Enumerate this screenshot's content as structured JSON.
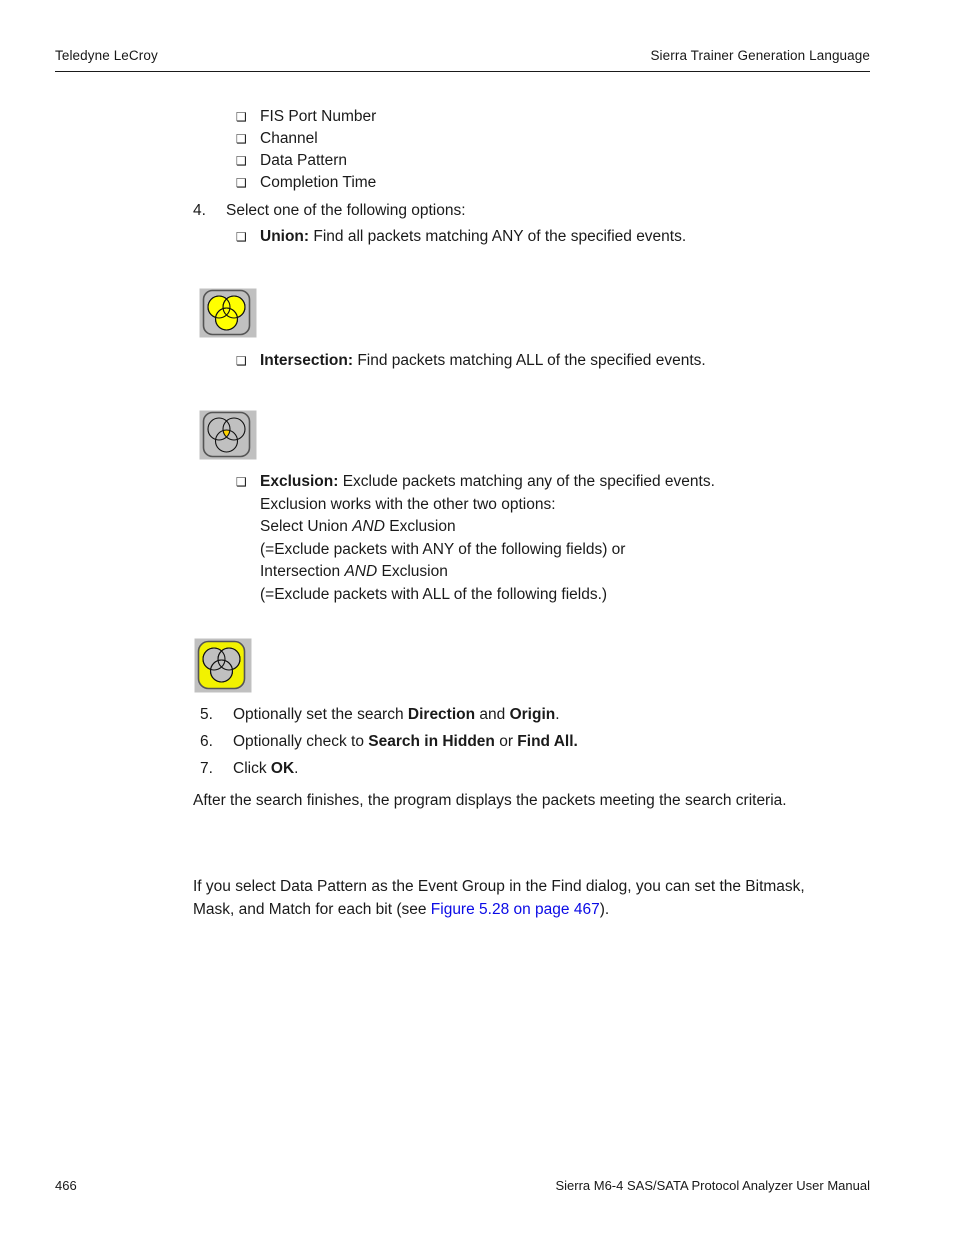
{
  "header": {
    "left": "Teledyne LeCroy",
    "right": "Sierra Trainer Generation Language"
  },
  "footer": {
    "page_number": "466",
    "manual_title": "Sierra M6-4 SAS/SATA Protocol Analyzer User Manual"
  },
  "field_bullets": [
    {
      "bullet": "❑",
      "label": "FIS Port Number"
    },
    {
      "bullet": "❑",
      "label": "Channel"
    },
    {
      "bullet": "❑",
      "label": "Data Pattern"
    },
    {
      "bullet": "❑",
      "label": "Completion Time"
    }
  ],
  "steps": {
    "step4": {
      "number": "4.",
      "text": "Select one of the following options:"
    },
    "step5": {
      "number": "5.",
      "prefix": "Optionally set the search ",
      "bold1": "Direction",
      "middle": " and ",
      "bold2": "Origin",
      "suffix": "."
    },
    "step6": {
      "number": "6.",
      "prefix": "Optionally check to ",
      "bold1": "Search in Hidden",
      "middle": " or ",
      "bold2": "Find All.",
      "suffix": ""
    },
    "step7": {
      "number": "7.",
      "prefix": "Click ",
      "bold1": "OK",
      "suffix": "."
    }
  },
  "options": {
    "union": {
      "bullet": "❑",
      "term": "Union:",
      "description": " Find all packets matching ANY of the specified events."
    },
    "intersection": {
      "bullet": "❑",
      "term": "Intersection:",
      "description": " Find packets matching ALL of the specified events."
    },
    "exclusion": {
      "bullet": "❑",
      "term": "Exclusion:",
      "description": " Exclude packets matching any of the specified events.",
      "line2": "Exclusion works with the other two options:",
      "line3_a": "Select Union ",
      "line3_italic": "AND",
      "line3_b": " Exclusion",
      "line4": "(=Exclude packets with ANY of the following fields) or",
      "line5_a": "Intersection ",
      "line5_italic": "AND",
      "line5_b": " Exclusion",
      "line6": "(=Exclude packets with ALL of the following fields.)"
    }
  },
  "icons": {
    "union": {
      "name": "union-venn-icon",
      "bg_color": "#f2f200",
      "plate_color": "#c0c0c0",
      "circle_fill": "#ffff00",
      "stroke": "#000000"
    },
    "intersection": {
      "name": "intersection-venn-icon",
      "bg_color": "#c0c0c0",
      "plate_color": "#c0c0c0",
      "circle_fill": "none",
      "center_fill": "#ffd400",
      "stroke": "#000000"
    },
    "exclusion": {
      "name": "exclusion-venn-icon",
      "bg_color": "#f2f200",
      "plate_color": "#c0c0c0",
      "circle_fill": "#c0c0c0",
      "stroke": "#000000"
    }
  },
  "paragraphs": {
    "after_search": "After the search finishes, the program displays the packets meeting the search criteria.",
    "data_pattern_line1": "If you select Data Pattern as the Event Group in the Find dialog, you can set the Bitmask,",
    "data_pattern_line2_a": "Mask, and Match for each bit (see ",
    "data_pattern_xref": "Figure 5.28 on page 467",
    "data_pattern_line2_b": ")."
  },
  "colors": {
    "text": "#1a1a1a",
    "link": "#0a0ae6",
    "rule": "#1a1a1a"
  }
}
